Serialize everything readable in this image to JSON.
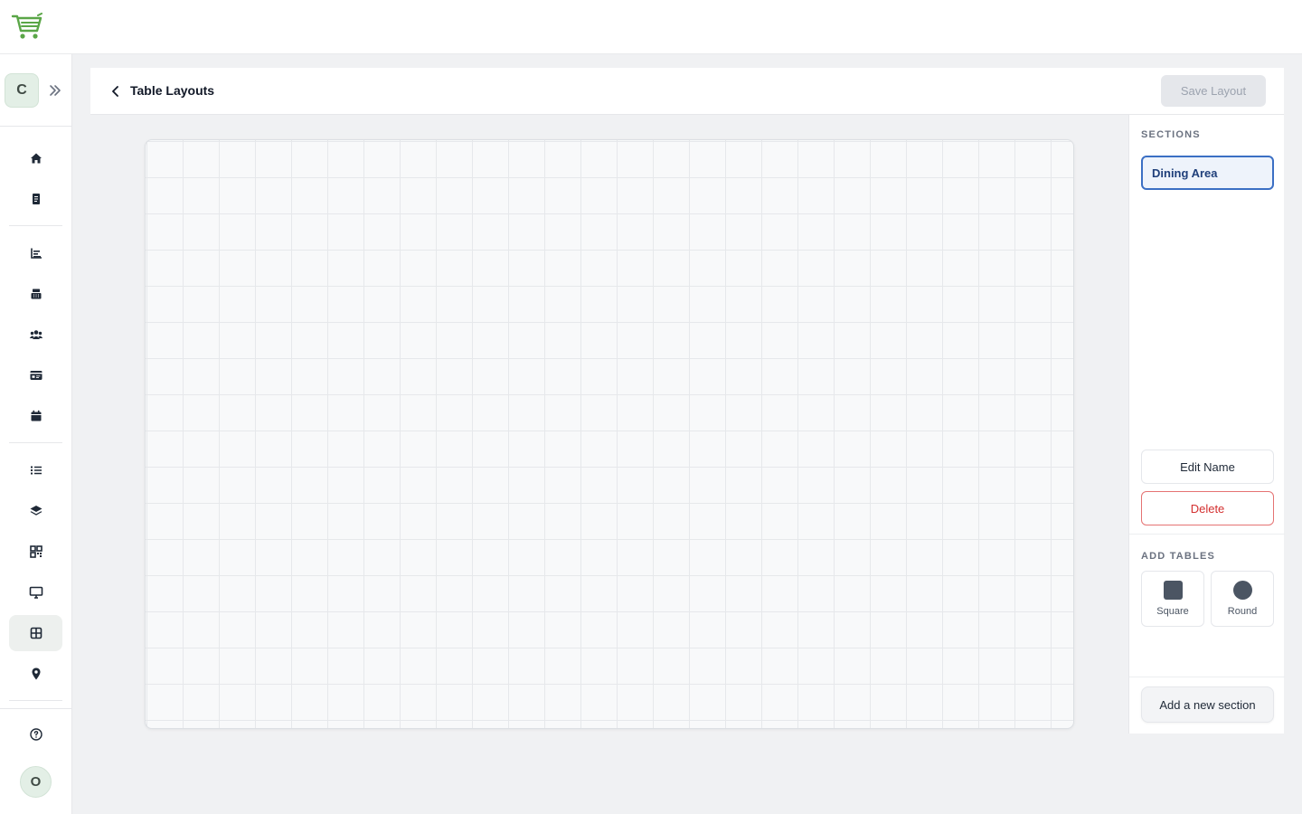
{
  "app": {
    "logo_icon": "shopping-cart-icon",
    "accent_color": "#5aa647"
  },
  "sidebar": {
    "workspace_initial": "C",
    "expand_icon": "double-chevron-right-icon",
    "nav_groups": [
      [
        {
          "name": "home",
          "icon": "home-icon"
        },
        {
          "name": "orders",
          "icon": "receipt-icon"
        }
      ],
      [
        {
          "name": "reports",
          "icon": "bar-chart-icon"
        },
        {
          "name": "register",
          "icon": "cash-register-icon"
        },
        {
          "name": "customers",
          "icon": "users-icon"
        },
        {
          "name": "cards",
          "icon": "id-card-icon"
        },
        {
          "name": "calendar",
          "icon": "calendar-icon"
        }
      ],
      [
        {
          "name": "menu-list",
          "icon": "list-icon"
        },
        {
          "name": "inventory",
          "icon": "layers-icon"
        },
        {
          "name": "qr-codes",
          "icon": "qr-code-icon"
        },
        {
          "name": "devices",
          "icon": "monitor-icon"
        },
        {
          "name": "table-layouts",
          "icon": "grid-icon",
          "active": true
        },
        {
          "name": "locations",
          "icon": "map-pin-icon"
        }
      ]
    ],
    "help_icon": "help-circle-icon",
    "user_initial": "O"
  },
  "header": {
    "back_icon": "chevron-left-icon",
    "title": "Table Layouts",
    "save_label": "Save Layout",
    "save_disabled": true
  },
  "canvas": {
    "grid": true
  },
  "panel": {
    "sections_heading": "SECTIONS",
    "sections": [
      {
        "label": "Dining Area",
        "selected": true
      }
    ],
    "edit_name_label": "Edit Name",
    "delete_label": "Delete",
    "add_tables_heading": "ADD TABLES",
    "table_shapes": [
      {
        "label": "Square",
        "shape": "square"
      },
      {
        "label": "Round",
        "shape": "round"
      }
    ],
    "add_section_label": "Add a new section"
  }
}
